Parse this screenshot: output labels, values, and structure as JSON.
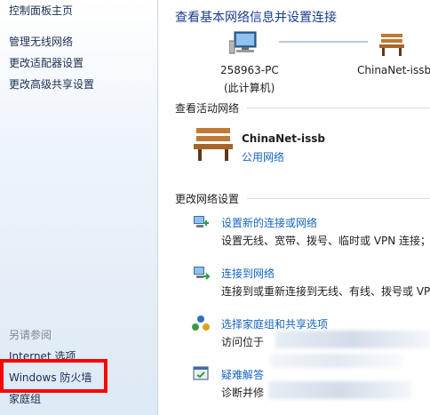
{
  "sidebar": {
    "home": "控制面板主页",
    "items": [
      "管理无线网络",
      "更改适配器设置",
      "更改高级共享设置"
    ],
    "see_also_heading": "另请参阅",
    "see_also": [
      "Internet 选项",
      "Windows 防火墙",
      "家庭组"
    ]
  },
  "header": {
    "title": "查看基本网络信息并设置连接"
  },
  "network_map": {
    "computer_name": "258963-PC",
    "computer_caption": "(此计算机)",
    "network_name": "ChinaNet-issb"
  },
  "active_networks": {
    "heading": "查看活动网络",
    "name": "ChinaNet-issb",
    "type": "公用网络"
  },
  "settings": {
    "heading": "更改网络设置",
    "tasks": [
      {
        "title": "设置新的连接或网络",
        "desc": "设置无线、宽带、拨号、临时或 VPN 连接；或",
        "icon": "network-setup-icon"
      },
      {
        "title": "连接到网络",
        "desc": "连接到或重新连接到无线、有线、拨号或 VPN",
        "icon": "connect-network-icon"
      },
      {
        "title": "选择家庭组和共享选项",
        "desc": "访问位于",
        "icon": "homegroup-icon"
      },
      {
        "title": "疑难解答",
        "desc": "诊断并修",
        "icon": "troubleshoot-icon"
      }
    ]
  },
  "colors": {
    "highlight_box": "#ff0000",
    "link": "#1565c0",
    "title": "#1a3d8f"
  }
}
